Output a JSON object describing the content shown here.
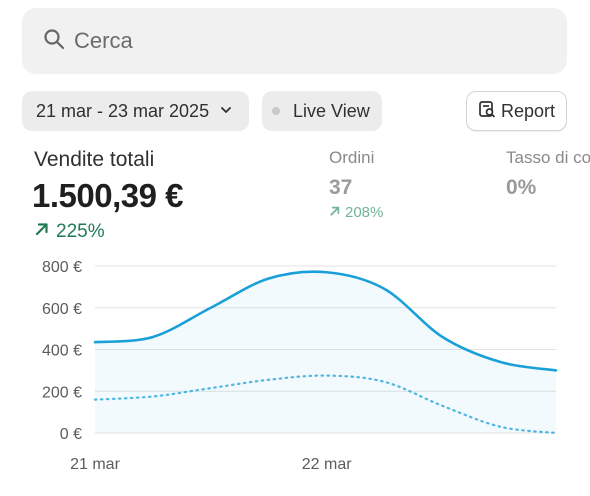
{
  "search": {
    "placeholder": "Cerca",
    "icon": "search-icon"
  },
  "toolbar": {
    "date_range": "21 mar - 23 mar 2025",
    "live_view": "Live View",
    "report": "Report"
  },
  "metrics": {
    "main": {
      "title": "Vendite totali",
      "value": "1.500,39 €",
      "change": "225%"
    },
    "orders": {
      "title": "Ordini",
      "value": "37",
      "change": "208%"
    },
    "conversion": {
      "title": "Tasso di co",
      "value": "0%"
    }
  },
  "colors": {
    "series_line": "#1aa0d8",
    "positive": "#1f7a55",
    "positive_muted": "#6fb497"
  },
  "chart_data": {
    "type": "line",
    "y_ticks": [
      "800 €",
      "600 €",
      "400 €",
      "200 €",
      "0 €"
    ],
    "y_tick_values": [
      800,
      600,
      400,
      200,
      0
    ],
    "x_ticks": [
      "21 mar",
      "22 mar"
    ],
    "x_tick_positions": [
      0,
      1
    ],
    "ylim": [
      0,
      800
    ],
    "xlim": [
      0,
      1.99
    ],
    "grid": true,
    "series": [
      {
        "style": "solid",
        "x": [
          0,
          0.25,
          0.5,
          0.75,
          1.0,
          1.25,
          1.5,
          1.75,
          1.99
        ],
        "values": [
          435,
          460,
          600,
          740,
          770,
          690,
          460,
          340,
          300
        ]
      },
      {
        "style": "dotted",
        "x": [
          0,
          0.25,
          0.5,
          0.75,
          1.0,
          1.25,
          1.5,
          1.75,
          1.99
        ],
        "values": [
          160,
          175,
          215,
          255,
          275,
          245,
          130,
          30,
          0
        ]
      }
    ]
  }
}
